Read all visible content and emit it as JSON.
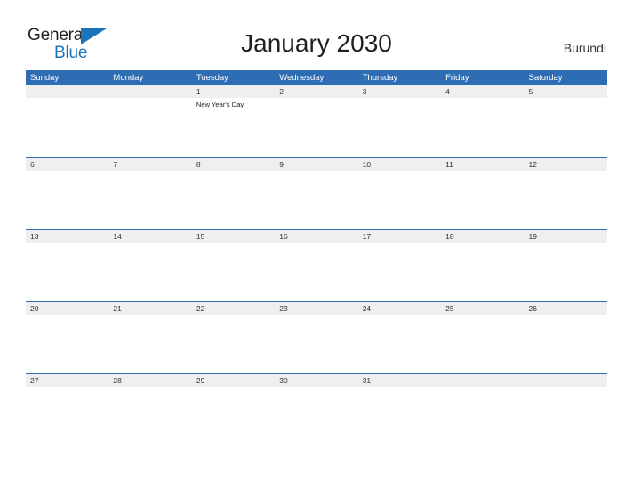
{
  "logo": {
    "text_part1": "General",
    "text_part2": "Blue",
    "triangle_icon": "blue-triangle-icon",
    "color_dark": "#231f20",
    "color_blue": "#1b75bb"
  },
  "header": {
    "title": "January 2030",
    "country": "Burundi"
  },
  "theme": {
    "header_blue": "#2e6db4",
    "band_gray": "#efefef",
    "text_dark": "#333333",
    "page_background": "#ffffff"
  },
  "calendar": {
    "month": "January",
    "year": "2030",
    "weekday_headers": [
      "Sunday",
      "Monday",
      "Tuesday",
      "Wednesday",
      "Thursday",
      "Friday",
      "Saturday"
    ],
    "weeks": [
      {
        "days": [
          {
            "date": "",
            "events": []
          },
          {
            "date": "",
            "events": []
          },
          {
            "date": "1",
            "events": [
              "New Year's Day"
            ]
          },
          {
            "date": "2",
            "events": []
          },
          {
            "date": "3",
            "events": []
          },
          {
            "date": "4",
            "events": []
          },
          {
            "date": "5",
            "events": []
          }
        ]
      },
      {
        "days": [
          {
            "date": "6",
            "events": []
          },
          {
            "date": "7",
            "events": []
          },
          {
            "date": "8",
            "events": []
          },
          {
            "date": "9",
            "events": []
          },
          {
            "date": "10",
            "events": []
          },
          {
            "date": "11",
            "events": []
          },
          {
            "date": "12",
            "events": []
          }
        ]
      },
      {
        "days": [
          {
            "date": "13",
            "events": []
          },
          {
            "date": "14",
            "events": []
          },
          {
            "date": "15",
            "events": []
          },
          {
            "date": "16",
            "events": []
          },
          {
            "date": "17",
            "events": []
          },
          {
            "date": "18",
            "events": []
          },
          {
            "date": "19",
            "events": []
          }
        ]
      },
      {
        "days": [
          {
            "date": "20",
            "events": []
          },
          {
            "date": "21",
            "events": []
          },
          {
            "date": "22",
            "events": []
          },
          {
            "date": "23",
            "events": []
          },
          {
            "date": "24",
            "events": []
          },
          {
            "date": "25",
            "events": []
          },
          {
            "date": "26",
            "events": []
          }
        ]
      },
      {
        "days": [
          {
            "date": "27",
            "events": []
          },
          {
            "date": "28",
            "events": []
          },
          {
            "date": "29",
            "events": []
          },
          {
            "date": "30",
            "events": []
          },
          {
            "date": "31",
            "events": []
          },
          {
            "date": "",
            "events": []
          },
          {
            "date": "",
            "events": []
          }
        ]
      }
    ]
  }
}
